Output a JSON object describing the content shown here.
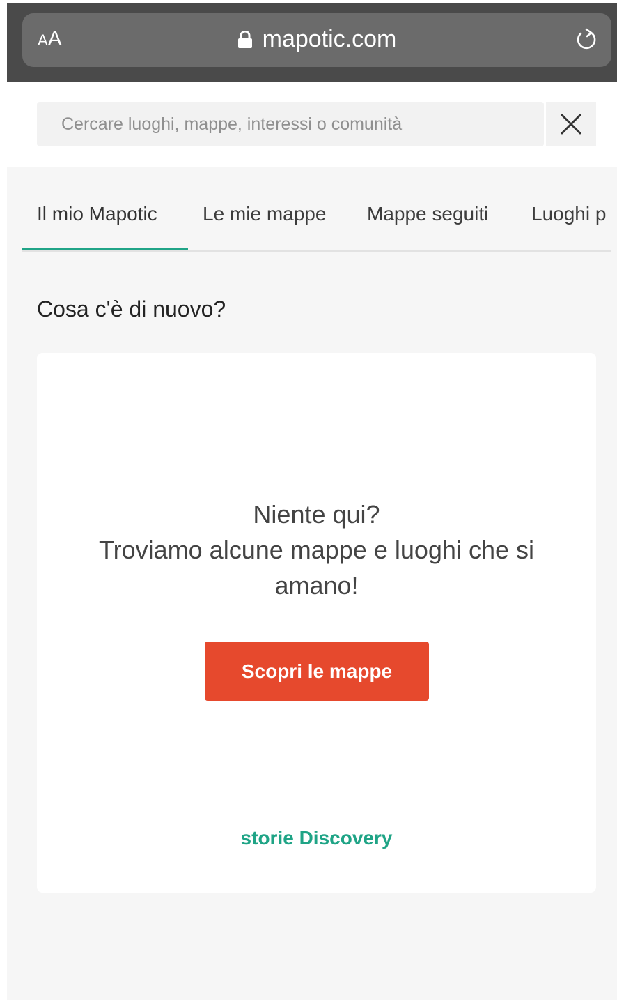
{
  "browser": {
    "aa_small": "A",
    "aa_big": "A",
    "url": "mapotic.com",
    "lock_icon": "lock-icon",
    "reload_icon": "reload-icon"
  },
  "search": {
    "placeholder": "Cercare luoghi, mappe, interessi o comunità",
    "value": "",
    "close_icon": "close-icon"
  },
  "tabs": [
    {
      "label": "Il mio Mapotic",
      "active": true
    },
    {
      "label": "Le mie mappe",
      "active": false
    },
    {
      "label": "Mappe seguiti",
      "active": false
    },
    {
      "label": "Luoghi p",
      "active": false
    }
  ],
  "main": {
    "section_title": "Cosa c'è di nuovo?",
    "empty_lines": [
      "Niente qui?",
      "Troviamo alcune mappe e luoghi che si",
      "amano!"
    ],
    "cta_label": "Scopri le mappe",
    "stories_link": "storie Discovery"
  },
  "colors": {
    "accent": "#20a487",
    "cta": "#e6492d",
    "browser_bar": "#4a4a4a"
  }
}
